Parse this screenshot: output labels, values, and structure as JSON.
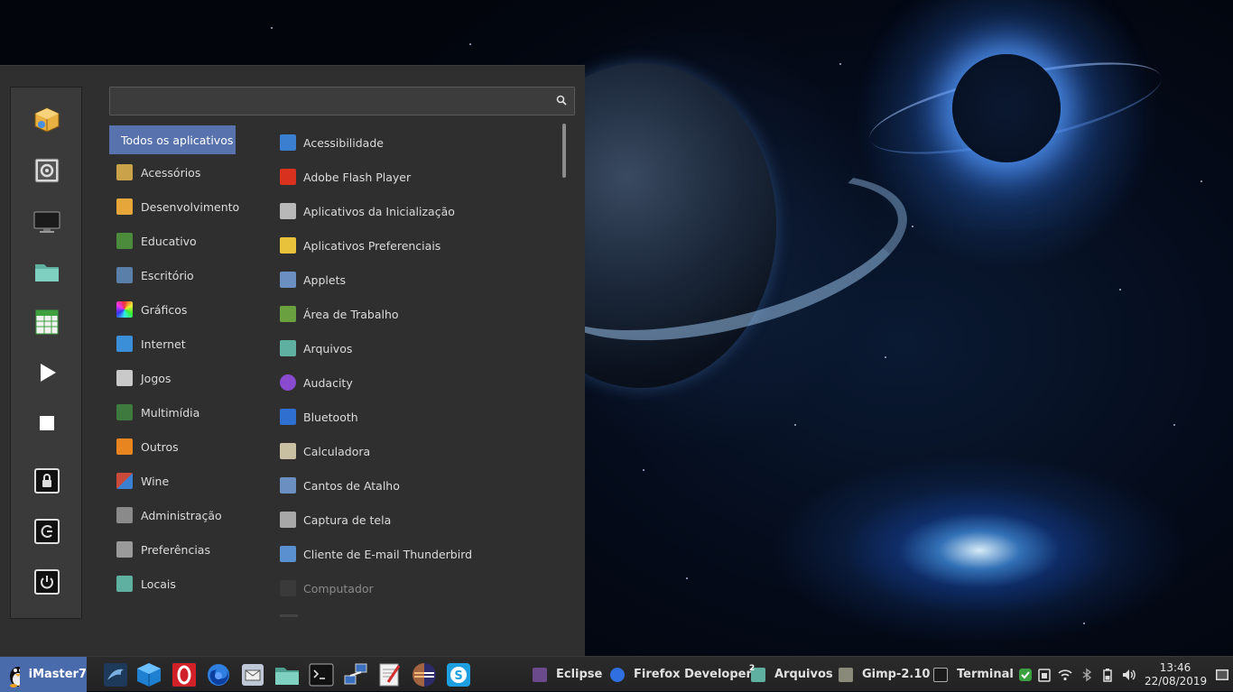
{
  "search": {
    "placeholder": ""
  },
  "categories": [
    {
      "label": "Todos os aplicativos",
      "color": "#5872ae"
    },
    {
      "label": "Acessórios",
      "color": "#c9a24a"
    },
    {
      "label": "Desenvolvimento",
      "color": "#e6a63a"
    },
    {
      "label": "Educativo",
      "color": "#4b8b3b"
    },
    {
      "label": "Escritório",
      "color": "#5a7fa8"
    },
    {
      "label": "Gráficos",
      "color": "#d94a8a"
    },
    {
      "label": "Internet",
      "color": "#3a8fd8"
    },
    {
      "label": "Jogos",
      "color": "#c9c9c9"
    },
    {
      "label": "Multimídia",
      "color": "#3e7a3e"
    },
    {
      "label": "Outros",
      "color": "#e8851e"
    },
    {
      "label": "Wine",
      "color": "#c84a3a"
    },
    {
      "label": "Administração",
      "color": "#8a8a8a"
    },
    {
      "label": "Preferências",
      "color": "#9a9a9a"
    },
    {
      "label": "Locais",
      "color": "#5fb0a0"
    }
  ],
  "apps": [
    {
      "label": "Acessibilidade",
      "color": "#3a7fd0"
    },
    {
      "label": "Adobe Flash Player",
      "color": "#d8321f"
    },
    {
      "label": "Aplicativos da Inicialização",
      "color": "#b8b8b8"
    },
    {
      "label": "Aplicativos Preferenciais",
      "color": "#e8c23a"
    },
    {
      "label": "Applets",
      "color": "#6a8fc0"
    },
    {
      "label": "Área de Trabalho",
      "color": "#6aa040"
    },
    {
      "label": "Arquivos",
      "color": "#5fb0a0"
    },
    {
      "label": "Audacity",
      "color": "#8a4ad0"
    },
    {
      "label": "Bluetooth",
      "color": "#2f6fd0"
    },
    {
      "label": "Calculadora",
      "color": "#c8c0a0"
    },
    {
      "label": "Cantos de Atalho",
      "color": "#6a8fc0"
    },
    {
      "label": "Captura de tela",
      "color": "#a8a8a8"
    },
    {
      "label": "Cliente de E-mail Thunderbird",
      "color": "#5a8fd0"
    },
    {
      "label": "Computador",
      "color": "#3a3a3a"
    }
  ],
  "favorites": [
    {
      "name": "package-icon",
      "color": "#e8b040"
    },
    {
      "name": "settings-panel-icon",
      "color": "#b0b0b0"
    },
    {
      "name": "monitor-icon",
      "color": "#222"
    },
    {
      "name": "folder-icon",
      "color": "#5fb0a0"
    },
    {
      "name": "spreadsheet-icon",
      "color": "#3fa040"
    },
    {
      "name": "play-icon",
      "color": "#fff"
    },
    {
      "name": "stop-icon",
      "color": "#fff"
    },
    {
      "name": "lock-icon",
      "color": "#fff"
    },
    {
      "name": "logout-icon",
      "color": "#fff"
    },
    {
      "name": "power-icon",
      "color": "#fff"
    }
  ],
  "taskbar": {
    "menu_label": "iMaster7",
    "launchers": [
      {
        "name": "mysql-workbench-icon",
        "color": "#3a6fa0"
      },
      {
        "name": "virtualbox-icon",
        "color": "#2f8fd8"
      },
      {
        "name": "opera-icon",
        "color": "#d0202a"
      },
      {
        "name": "firefox-icon",
        "color": "#2f7fe0"
      },
      {
        "name": "thunderbird-icon",
        "color": "#8aa0c0"
      },
      {
        "name": "files-icon",
        "color": "#5fb0a0"
      },
      {
        "name": "terminal-icon",
        "color": "#1a1a1a"
      },
      {
        "name": "network-icon",
        "color": "#3a6fc0"
      },
      {
        "name": "text-editor-icon",
        "color": "#d0d0d0"
      },
      {
        "name": "eclipse-icon",
        "color": "#2c2a6a"
      },
      {
        "name": "skype-icon",
        "color": "#1ea0e0"
      }
    ],
    "windows": [
      {
        "label": "Eclipse",
        "color": "#6a4a8a"
      },
      {
        "label": "Firefox Developer...",
        "color": "#2f6fe0"
      },
      {
        "label": "Arquivos",
        "color": "#5fb0a0",
        "badge": "2"
      },
      {
        "label": "Gimp-2.10",
        "color": "#8a8a7a"
      },
      {
        "label": "Terminal",
        "color": "#1a1a1a"
      }
    ],
    "clock_time": "13:46",
    "clock_date": "22/08/2019"
  }
}
